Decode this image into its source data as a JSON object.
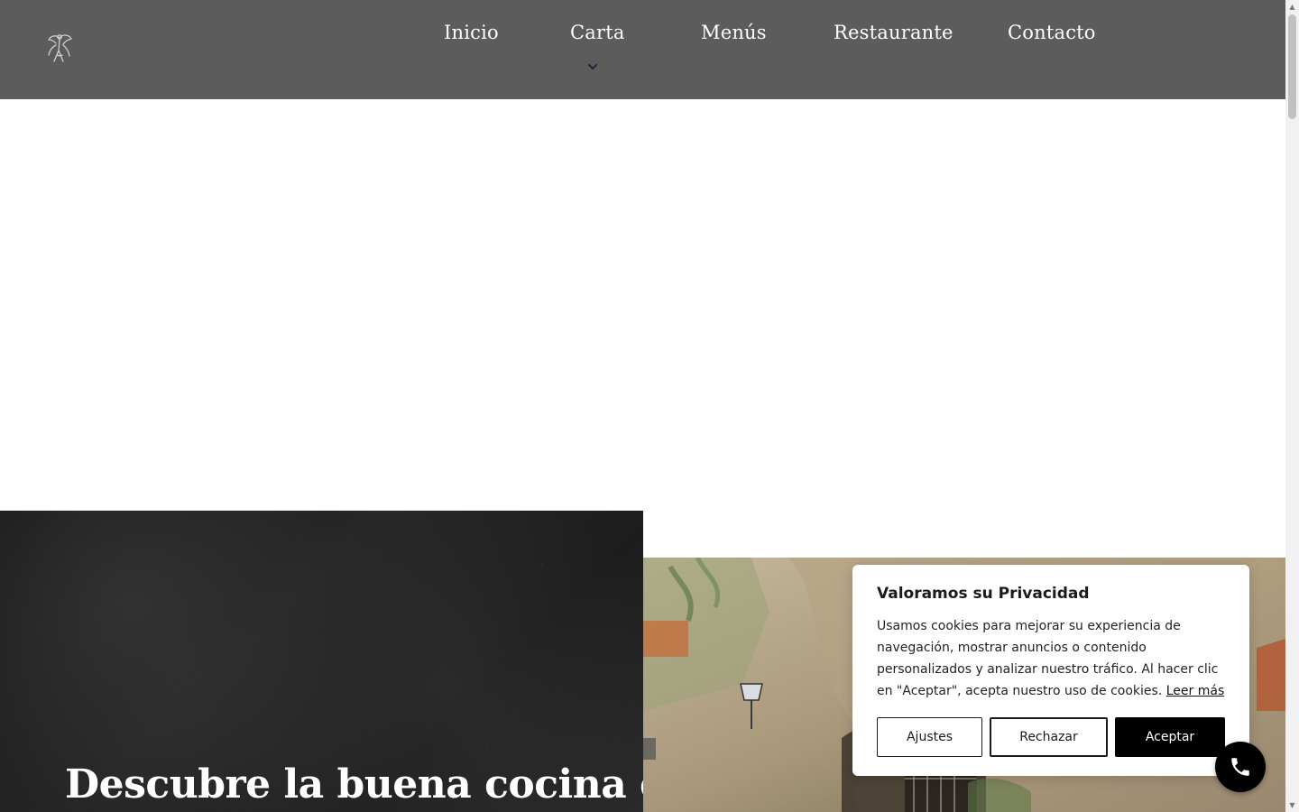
{
  "nav": {
    "items": [
      {
        "label": "Inicio"
      },
      {
        "label": "Carta"
      },
      {
        "label": "Menús"
      },
      {
        "label": "Restaurante"
      },
      {
        "label": "Contacto"
      }
    ]
  },
  "hero": {
    "title": "Descubre la buena cocina en"
  },
  "cookie": {
    "title": "Valoramos su Privacidad",
    "text": "Usamos cookies para mejorar su experiencia de navegación, mostrar anuncios o contenido personalizados y analizar nuestro tráfico. Al hacer clic en \"Aceptar\", acepta nuestro uso de cookies.",
    "link": "Leer más",
    "buttons": {
      "settings": "Ajustes",
      "reject": "Rechazar",
      "accept": "Aceptar"
    }
  },
  "icons": {
    "logo": "winged-creature-logo",
    "dropdown": "chevron-down-icon",
    "phone": "phone-icon"
  },
  "colors": {
    "header_bg": "#5c5c5c",
    "chevron": "#2a2440",
    "accept_bg": "#000000"
  }
}
